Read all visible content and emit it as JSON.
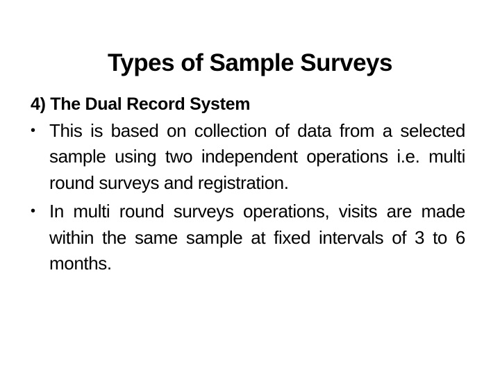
{
  "slide": {
    "title": "Types of Sample Surveys",
    "subheading": "4) The Dual Record System",
    "bullet_symbol": "•",
    "bullets": [
      {
        "text": "This is based on collection of data from a selected sample using two independent operations i.e. multi round surveys and registration."
      },
      {
        "text": "In multi round surveys operations, visits are made within the same sample at fixed intervals of 3 to 6 months."
      }
    ]
  }
}
